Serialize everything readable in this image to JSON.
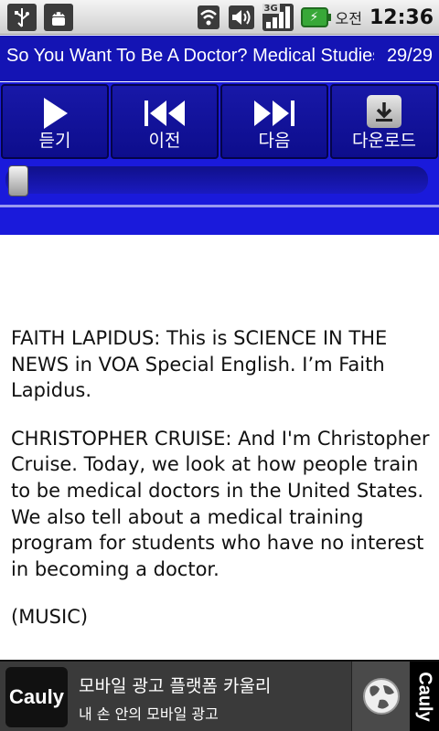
{
  "status_bar": {
    "ampm": "오전",
    "time": "12:36",
    "network": "3G",
    "icons": [
      "usb-icon",
      "android-debug-icon",
      "wifi-icon",
      "volume-icon",
      "signal-icon",
      "battery-charging-icon"
    ]
  },
  "title_bar": {
    "title": "So You Want To Be A Doctor? Medical Studies",
    "counter": "29/29"
  },
  "controls": {
    "buttons": [
      {
        "label": "듣기",
        "icon": "play-icon"
      },
      {
        "label": "이전",
        "icon": "previous-icon"
      },
      {
        "label": "다음",
        "icon": "next-icon"
      },
      {
        "label": "다운로드",
        "icon": "download-icon"
      }
    ],
    "seek_progress": 0.0
  },
  "article": {
    "paragraphs": [
      "FAITH LAPIDUS: This is SCIENCE IN THE NEWS in VOA Special English. I’m Faith Lapidus.",
      "CHRISTOPHER CRUISE: And I'm Christopher Cruise. Today, we look at how people train to be medical doctors in the United States. We also tell about a medical training program for students who have no interest in becoming a doctor.",
      "(MUSIC)"
    ]
  },
  "ad": {
    "logo_text": "Cauly",
    "title": "모바일 광고 플랫폼 카울리",
    "subtitle": "내 손 안의 모바일 광고",
    "side_label": "Cauly",
    "colors": {
      "logo_accent": "#f2c300"
    }
  },
  "colors": {
    "title_bg": "#1414b4",
    "controls_bg": "#1a1adb"
  }
}
